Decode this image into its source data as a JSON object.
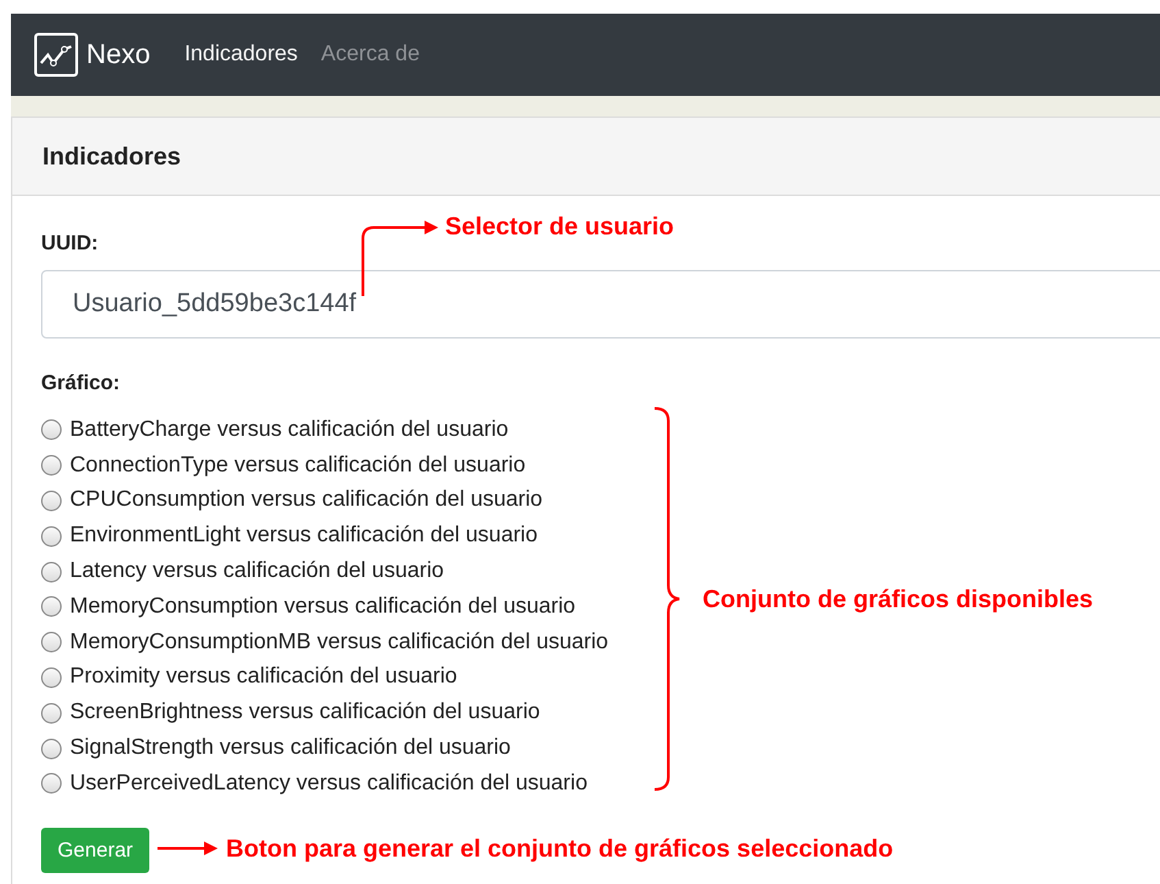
{
  "navbar": {
    "brand": "Nexo",
    "items": [
      {
        "label": "Indicadores",
        "selected": true
      },
      {
        "label": "Acerca de",
        "selected": false
      }
    ]
  },
  "card": {
    "title": "Indicadores",
    "uuid": {
      "label": "UUID:",
      "value": "Usuario_5dd59be3c144f"
    },
    "chart": {
      "label": "Gráfico:",
      "options": [
        {
          "label": "BatteryCharge versus calificación del usuario",
          "selected": false
        },
        {
          "label": "ConnectionType versus calificación del usuario",
          "selected": false
        },
        {
          "label": "CPUConsumption versus calificación del usuario",
          "selected": false
        },
        {
          "label": "EnvironmentLight versus calificación del usuario",
          "selected": false
        },
        {
          "label": "Latency versus calificación del usuario",
          "selected": false
        },
        {
          "label": "MemoryConsumption versus calificación del usuario",
          "selected": false
        },
        {
          "label": "MemoryConsumptionMB versus calificación del usuario",
          "selected": false
        },
        {
          "label": "Proximity versus calificación del usuario",
          "selected": false
        },
        {
          "label": "ScreenBrightness versus calificación del usuario",
          "selected": false
        },
        {
          "label": "SignalStrength versus calificación del usuario",
          "selected": false
        },
        {
          "label": "UserPerceivedLatency versus calificación del usuario",
          "selected": false
        }
      ]
    },
    "button": "Generar"
  },
  "annotations": [
    {
      "kind": "elbow",
      "text": "Selector de usuario"
    },
    {
      "kind": "bracket",
      "text": "Conjunto de gráficos disponibles"
    },
    {
      "kind": "arrow",
      "text": "Boton para generar el conjunto de gráficos seleccionado"
    }
  ]
}
